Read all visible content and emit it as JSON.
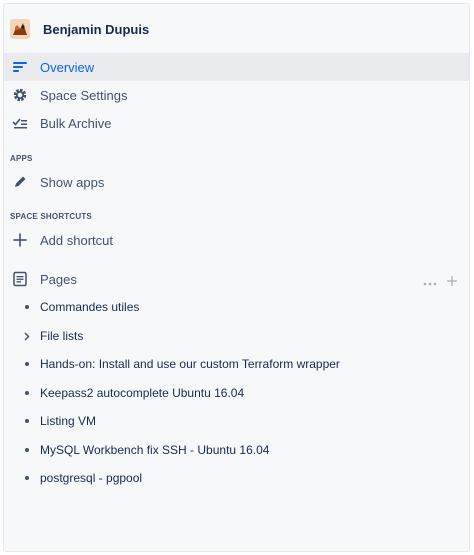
{
  "space": {
    "name": "Benjamin Dupuis"
  },
  "nav": [
    {
      "label": "Overview",
      "icon": "overview-icon"
    },
    {
      "label": "Space Settings",
      "icon": "gear-icon"
    },
    {
      "label": "Bulk Archive",
      "icon": "bulk-archive-icon"
    }
  ],
  "apps": {
    "title": "APPS",
    "items": [
      {
        "label": "Show apps",
        "icon": "pencil-icon"
      }
    ]
  },
  "shortcuts": {
    "title": "SPACE SHORTCUTS",
    "items": [
      {
        "label": "Add shortcut",
        "icon": "plus-icon"
      }
    ]
  },
  "pages": {
    "title": "Pages",
    "items": [
      {
        "label": "Commandes utiles",
        "type": "bullet"
      },
      {
        "label": "File lists",
        "type": "chevron"
      },
      {
        "label": "Hands-on: Install and use our custom Terraform wrapper",
        "type": "bullet"
      },
      {
        "label": "Keepass2 autocomplete Ubuntu 16.04",
        "type": "bullet"
      },
      {
        "label": "Listing VM",
        "type": "bullet"
      },
      {
        "label": "MySQL Workbench fix SSH - Ubuntu 16.04",
        "type": "bullet"
      },
      {
        "label": "postgresql - pgpool",
        "type": "bullet"
      }
    ]
  },
  "colors": {
    "accent": "#0c66e4",
    "active_bg": "#e9ebee",
    "panel_bg": "#f7f8f9",
    "text": "#172b4d",
    "subtle": "#42526e"
  }
}
